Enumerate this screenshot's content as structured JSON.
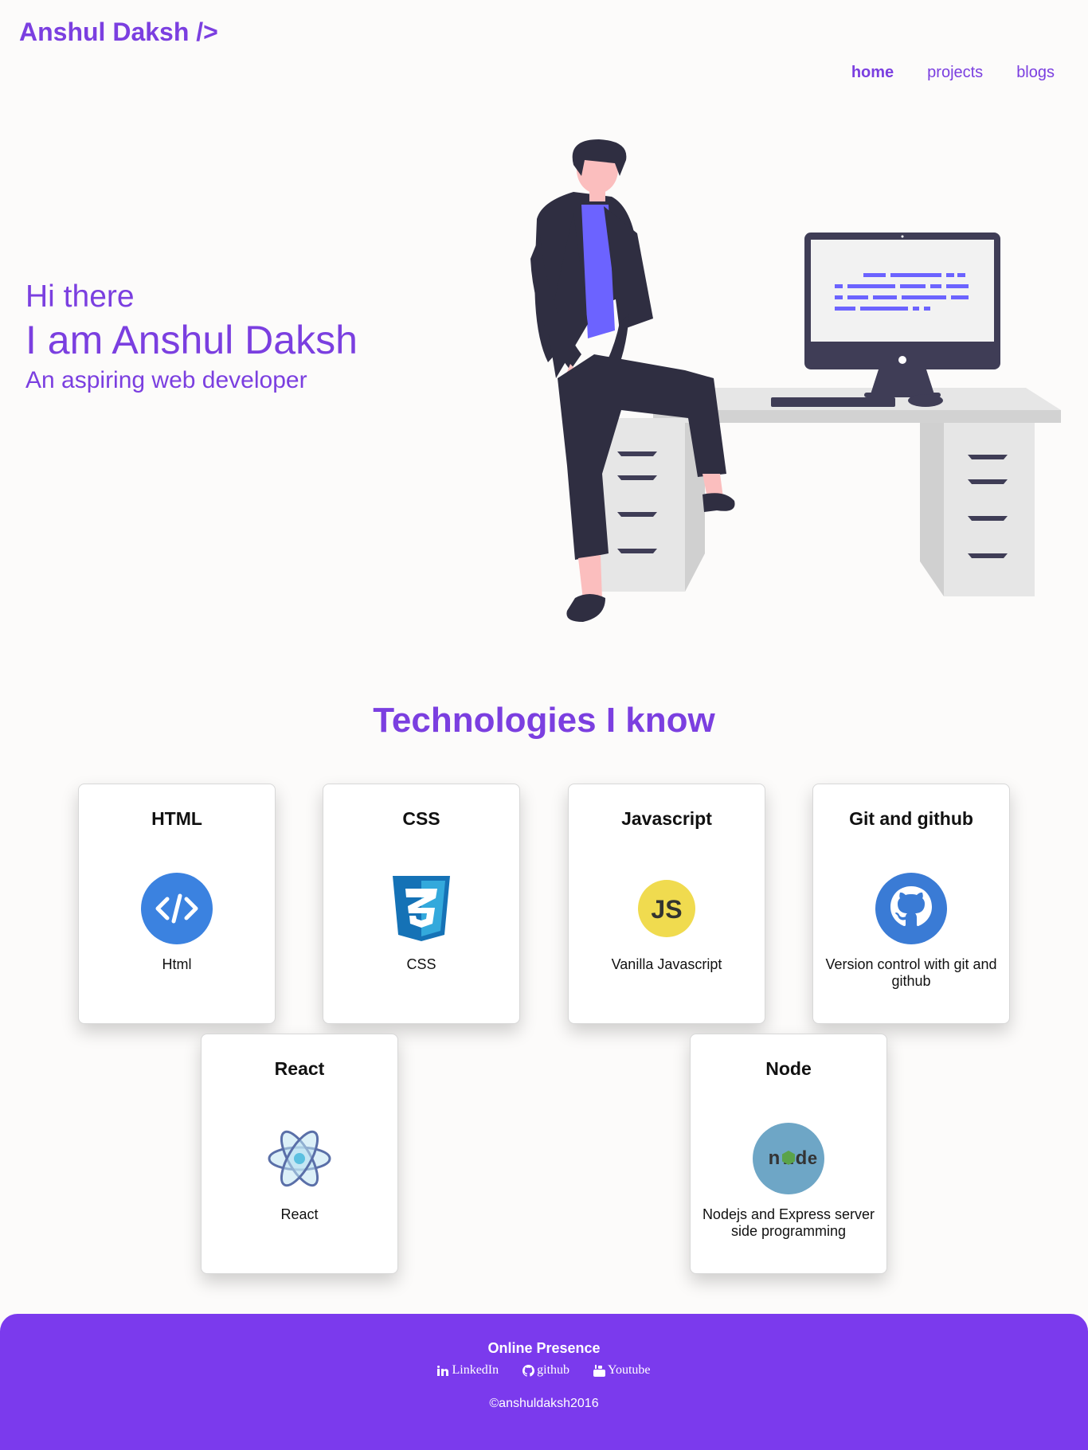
{
  "brand": {
    "logo": "Anshul Daksh />",
    "accent": "#7b3fe0"
  },
  "nav": {
    "home": "home",
    "projects": "projects",
    "blogs": "blogs"
  },
  "hero": {
    "greeting": "Hi there",
    "name": "I am Anshul Daksh",
    "tagline": "An aspiring web developer"
  },
  "tech": {
    "title": "Technologies I know",
    "cards": [
      {
        "title": "HTML",
        "icon": "html-code-icon",
        "desc": "Html"
      },
      {
        "title": "CSS",
        "icon": "css3-shield-icon",
        "desc": "CSS"
      },
      {
        "title": "Javascript",
        "icon": "js-icon",
        "desc": "Vanilla Javascript"
      },
      {
        "title": "Git and github",
        "icon": "github-octocat-icon",
        "desc": "Version control with git and github"
      },
      {
        "title": "React",
        "icon": "react-atom-icon",
        "desc": "React"
      },
      {
        "title": "Node",
        "icon": "nodejs-icon",
        "desc": "Nodejs and Express server side programming"
      }
    ]
  },
  "footer": {
    "heading": "Online Presence",
    "links": {
      "linkedin": "LinkedIn",
      "github": "github",
      "youtube": "Youtube"
    },
    "copyright": "©anshuldaksh2016",
    "background": "#7b3aed"
  }
}
